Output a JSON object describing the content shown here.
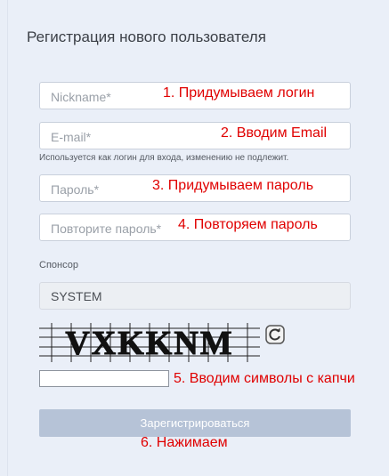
{
  "form": {
    "title": "Регистрация нового пользователя",
    "nickname_placeholder": "Nickname*",
    "email_placeholder": "E-mail*",
    "email_hint": "Используется как логин для входа, изменению не подлежит.",
    "password_placeholder": "Пароль*",
    "password_repeat_placeholder": "Повторите пароль*",
    "sponsor_label": "Спонсор",
    "sponsor_value": "SYSTEM",
    "captcha_text": "VXKKNM",
    "submit_label": "Зарегистрироваться"
  },
  "annotations": {
    "step1": "1. Придумываем логин",
    "step2": "2. Вводим Email",
    "step3": "3. Придумываем пароль",
    "step4": "4. Повторяем пароль",
    "step5": "5. Вводим символы с капчи",
    "step6": "6. Нажимаем"
  },
  "colors": {
    "annotation": "#e00000",
    "submit_bg": "#b6c3d7",
    "background": "#eaeff8"
  },
  "icons": {
    "refresh": "refresh-icon"
  }
}
